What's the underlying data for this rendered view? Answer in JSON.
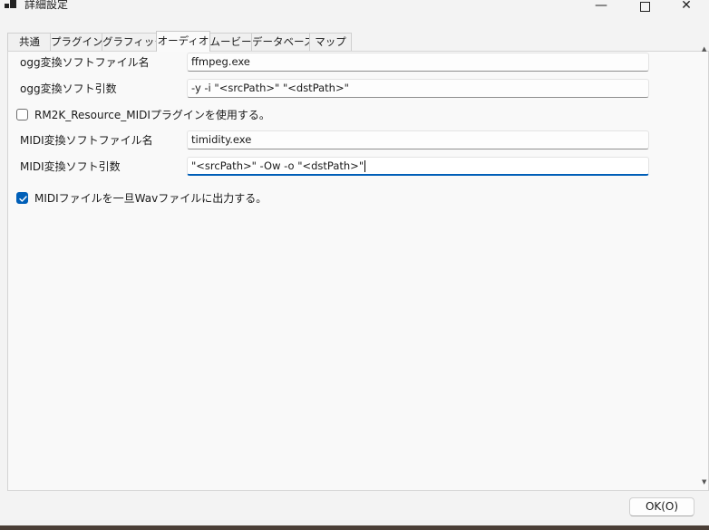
{
  "window": {
    "title": "詳細設定",
    "minimize_glyph": "—",
    "close_glyph": "✕"
  },
  "tabs": [
    {
      "label": "共通"
    },
    {
      "label": "プラグイン"
    },
    {
      "label": "グラフィック"
    },
    {
      "label": "オーディオ",
      "active": true
    },
    {
      "label": "ムービー"
    },
    {
      "label": "データベース"
    },
    {
      "label": "マップ"
    }
  ],
  "audio": {
    "ogg_exe_label": "ogg変換ソフトファイル名",
    "ogg_exe_value": "ffmpeg.exe",
    "ogg_args_label": "ogg変換ソフト引数",
    "ogg_args_value": "-y -i \"<srcPath>\" \"<dstPath>\"",
    "rm2k_plugin_label": "RM2K_Resource_MIDIプラグインを使用する。",
    "rm2k_plugin_checked": false,
    "midi_exe_label": "MIDI変換ソフトファイル名",
    "midi_exe_value": "timidity.exe",
    "midi_args_label": "MIDI変換ソフト引数",
    "midi_args_value": "\"<srcPath>\" -Ow -o \"<dstPath>\"",
    "midi_wav_label": "MIDIファイルを一旦Wavファイルに出力する。",
    "midi_wav_checked": true
  },
  "footer": {
    "ok_label": "OK(O)"
  },
  "colors": {
    "accent": "#005fb8",
    "window_bg": "#f3f3f3",
    "panel_bg": "#f9f9f9"
  }
}
